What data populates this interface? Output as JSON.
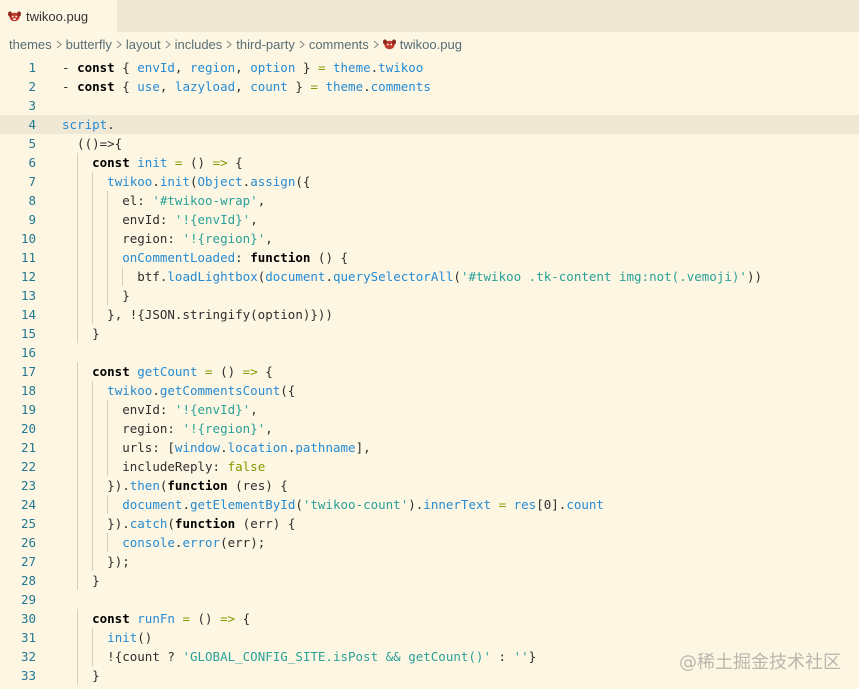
{
  "tab": {
    "label": "twikoo.pug",
    "icon": "pug-file-icon"
  },
  "breadcrumb": [
    "themes",
    "butterfly",
    "layout",
    "includes",
    "third-party",
    "comments",
    "twikoo.pug"
  ],
  "watermark": "@稀土掘金技术社区",
  "current_line": 4,
  "lines": [
    {
      "n": "1",
      "indent": 0,
      "tokens": [
        [
          "pl",
          "- "
        ],
        [
          "kw",
          "const"
        ],
        [
          "pl",
          " { "
        ],
        [
          "var",
          "envId"
        ],
        [
          "pl",
          ", "
        ],
        [
          "var",
          "region"
        ],
        [
          "pl",
          ", "
        ],
        [
          "var",
          "option"
        ],
        [
          "pl",
          " } "
        ],
        [
          "op",
          "="
        ],
        [
          "pl",
          " "
        ],
        [
          "var",
          "theme"
        ],
        [
          "pl",
          "."
        ],
        [
          "var",
          "twikoo"
        ]
      ]
    },
    {
      "n": "2",
      "indent": 0,
      "tokens": [
        [
          "pl",
          "- "
        ],
        [
          "kw",
          "const"
        ],
        [
          "pl",
          " { "
        ],
        [
          "var",
          "use"
        ],
        [
          "pl",
          ", "
        ],
        [
          "var",
          "lazyload"
        ],
        [
          "pl",
          ", "
        ],
        [
          "var",
          "count"
        ],
        [
          "pl",
          " } "
        ],
        [
          "op",
          "="
        ],
        [
          "pl",
          " "
        ],
        [
          "var",
          "theme"
        ],
        [
          "pl",
          "."
        ],
        [
          "var",
          "comments"
        ]
      ]
    },
    {
      "n": "3",
      "indent": 0,
      "tokens": []
    },
    {
      "n": "4",
      "indent": 0,
      "tokens": [
        [
          "tag",
          "script"
        ],
        [
          "pl",
          "."
        ]
      ]
    },
    {
      "n": "5",
      "indent": 1,
      "tokens": [
        [
          "pl",
          "(()=>{"
        ]
      ]
    },
    {
      "n": "6",
      "indent": 2,
      "tokens": [
        [
          "kw",
          "const"
        ],
        [
          "pl",
          " "
        ],
        [
          "fn",
          "init"
        ],
        [
          "pl",
          " "
        ],
        [
          "op",
          "="
        ],
        [
          "pl",
          " () "
        ],
        [
          "op",
          "=>"
        ],
        [
          "pl",
          " {"
        ]
      ]
    },
    {
      "n": "7",
      "indent": 3,
      "tokens": [
        [
          "var",
          "twikoo"
        ],
        [
          "pl",
          "."
        ],
        [
          "fn",
          "init"
        ],
        [
          "pl",
          "("
        ],
        [
          "var",
          "Object"
        ],
        [
          "pl",
          "."
        ],
        [
          "fn",
          "assign"
        ],
        [
          "pl",
          "({"
        ]
      ]
    },
    {
      "n": "8",
      "indent": 4,
      "tokens": [
        [
          "pl",
          "el: "
        ],
        [
          "str",
          "'#twikoo-wrap'"
        ],
        [
          "pl",
          ","
        ]
      ]
    },
    {
      "n": "9",
      "indent": 4,
      "tokens": [
        [
          "pl",
          "envId: "
        ],
        [
          "str",
          "'!{envId}'"
        ],
        [
          "pl",
          ","
        ]
      ]
    },
    {
      "n": "10",
      "indent": 4,
      "tokens": [
        [
          "pl",
          "region: "
        ],
        [
          "str",
          "'!{region}'"
        ],
        [
          "pl",
          ","
        ]
      ]
    },
    {
      "n": "11",
      "indent": 4,
      "tokens": [
        [
          "fn",
          "onCommentLoaded"
        ],
        [
          "pl",
          ": "
        ],
        [
          "kw",
          "function"
        ],
        [
          "pl",
          " () {"
        ]
      ]
    },
    {
      "n": "12",
      "indent": 5,
      "tokens": [
        [
          "pl",
          "btf."
        ],
        [
          "fn",
          "loadLightbox"
        ],
        [
          "pl",
          "("
        ],
        [
          "var",
          "document"
        ],
        [
          "pl",
          "."
        ],
        [
          "fn",
          "querySelectorAll"
        ],
        [
          "pl",
          "("
        ],
        [
          "str",
          "'#twikoo .tk-content img:not(.vemoji)'"
        ],
        [
          "pl",
          "))"
        ]
      ]
    },
    {
      "n": "13",
      "indent": 4,
      "tokens": [
        [
          "pl",
          "}"
        ]
      ]
    },
    {
      "n": "14",
      "indent": 3,
      "tokens": [
        [
          "pl",
          "}, !{JSON.stringify(option)}))"
        ]
      ]
    },
    {
      "n": "15",
      "indent": 2,
      "tokens": [
        [
          "pl",
          "}"
        ]
      ]
    },
    {
      "n": "16",
      "indent": 0,
      "tokens": []
    },
    {
      "n": "17",
      "indent": 2,
      "tokens": [
        [
          "kw",
          "const"
        ],
        [
          "pl",
          " "
        ],
        [
          "fn",
          "getCount"
        ],
        [
          "pl",
          " "
        ],
        [
          "op",
          "="
        ],
        [
          "pl",
          " () "
        ],
        [
          "op",
          "=>"
        ],
        [
          "pl",
          " {"
        ]
      ]
    },
    {
      "n": "18",
      "indent": 3,
      "tokens": [
        [
          "var",
          "twikoo"
        ],
        [
          "pl",
          "."
        ],
        [
          "fn",
          "getCommentsCount"
        ],
        [
          "pl",
          "({"
        ]
      ]
    },
    {
      "n": "19",
      "indent": 4,
      "tokens": [
        [
          "pl",
          "envId: "
        ],
        [
          "str",
          "'!{envId}'"
        ],
        [
          "pl",
          ","
        ]
      ]
    },
    {
      "n": "20",
      "indent": 4,
      "tokens": [
        [
          "pl",
          "region: "
        ],
        [
          "str",
          "'!{region}'"
        ],
        [
          "pl",
          ","
        ]
      ]
    },
    {
      "n": "21",
      "indent": 4,
      "tokens": [
        [
          "pl",
          "urls: ["
        ],
        [
          "var",
          "window"
        ],
        [
          "pl",
          "."
        ],
        [
          "var",
          "location"
        ],
        [
          "pl",
          "."
        ],
        [
          "var",
          "pathname"
        ],
        [
          "pl",
          "],"
        ]
      ]
    },
    {
      "n": "22",
      "indent": 4,
      "tokens": [
        [
          "pl",
          "includeReply: "
        ],
        [
          "bool",
          "false"
        ]
      ]
    },
    {
      "n": "23",
      "indent": 3,
      "tokens": [
        [
          "pl",
          "})."
        ],
        [
          "fn",
          "then"
        ],
        [
          "pl",
          "("
        ],
        [
          "kw",
          "function"
        ],
        [
          "pl",
          " (res) {"
        ]
      ]
    },
    {
      "n": "24",
      "indent": 4,
      "tokens": [
        [
          "var",
          "document"
        ],
        [
          "pl",
          "."
        ],
        [
          "fn",
          "getElementById"
        ],
        [
          "pl",
          "("
        ],
        [
          "str",
          "'twikoo-count'"
        ],
        [
          "pl",
          ")."
        ],
        [
          "var",
          "innerText"
        ],
        [
          "pl",
          " "
        ],
        [
          "op",
          "="
        ],
        [
          "pl",
          " "
        ],
        [
          "var",
          "res"
        ],
        [
          "pl",
          "[0]."
        ],
        [
          "var",
          "count"
        ]
      ]
    },
    {
      "n": "25",
      "indent": 3,
      "tokens": [
        [
          "pl",
          "})."
        ],
        [
          "fn",
          "catch"
        ],
        [
          "pl",
          "("
        ],
        [
          "kw",
          "function"
        ],
        [
          "pl",
          " (err) {"
        ]
      ]
    },
    {
      "n": "26",
      "indent": 4,
      "tokens": [
        [
          "var",
          "console"
        ],
        [
          "pl",
          "."
        ],
        [
          "fn",
          "error"
        ],
        [
          "pl",
          "(err);"
        ]
      ]
    },
    {
      "n": "27",
      "indent": 3,
      "tokens": [
        [
          "pl",
          "});"
        ]
      ]
    },
    {
      "n": "28",
      "indent": 2,
      "tokens": [
        [
          "pl",
          "}"
        ]
      ]
    },
    {
      "n": "29",
      "indent": 0,
      "tokens": []
    },
    {
      "n": "30",
      "indent": 2,
      "tokens": [
        [
          "kw",
          "const"
        ],
        [
          "pl",
          " "
        ],
        [
          "fn",
          "runFn"
        ],
        [
          "pl",
          " "
        ],
        [
          "op",
          "="
        ],
        [
          "pl",
          " () "
        ],
        [
          "op",
          "=>"
        ],
        [
          "pl",
          " {"
        ]
      ]
    },
    {
      "n": "31",
      "indent": 3,
      "tokens": [
        [
          "fn",
          "init"
        ],
        [
          "pl",
          "()"
        ]
      ]
    },
    {
      "n": "32",
      "indent": 3,
      "tokens": [
        [
          "pl",
          "!{count ? "
        ],
        [
          "str",
          "'GLOBAL_CONFIG_SITE.isPost && getCount()'"
        ],
        [
          "pl",
          " : "
        ],
        [
          "str",
          "''"
        ],
        [
          "pl",
          "}"
        ]
      ]
    },
    {
      "n": "33",
      "indent": 2,
      "tokens": [
        [
          "pl",
          "}"
        ]
      ]
    }
  ]
}
